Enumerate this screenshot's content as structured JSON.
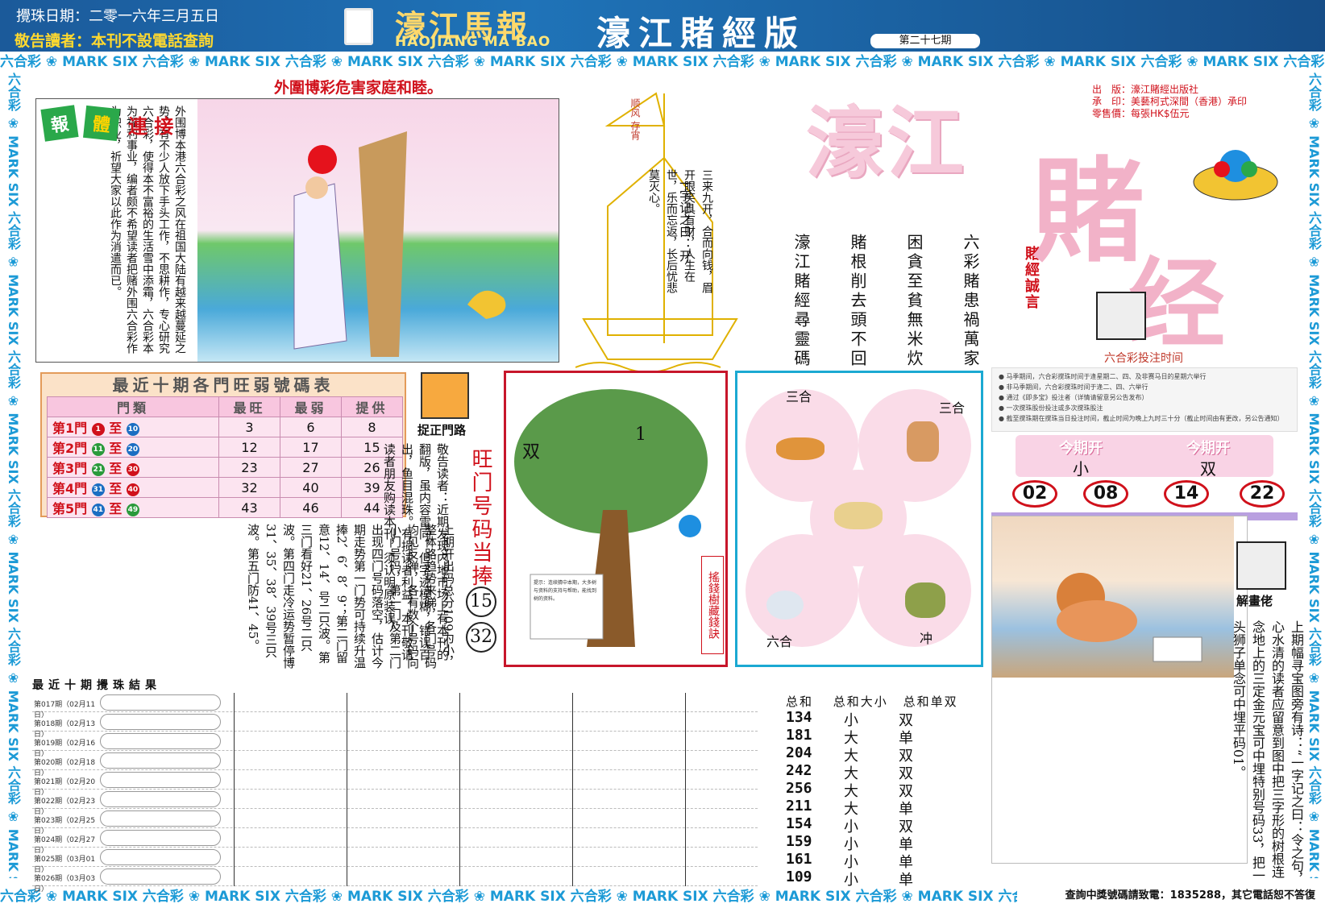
{
  "header": {
    "date": "攪珠日期：二零一六年三月五日",
    "warning": "敬告讀者：本刊不設電話查詢",
    "logo_cn": "濠江馬報",
    "logo_en": "HAOJIANG MA BAO",
    "edition": "濠江賭經版",
    "issue": "第二十七期"
  },
  "strips": {
    "unit": "六合彩 ❀ MARK SIX "
  },
  "slogan": "外圍博彩危害家庭和睦。",
  "story": {
    "badge_left": "報",
    "badge_mid": "體",
    "badge_right": "連 接",
    "text": "外围博本港六合彩之风在祖国大陆有越来越蔓延之势，有不少人放下手头工作，不思耕作，专心研究六合彩，使得本不富裕的生活雪中添霜，六合彩本为福利事业，编者颇不希望读者把赌外围六合彩作为职业，祈望大家以此作为消遣而已。"
  },
  "ship": {
    "flag": "顺风\n存宵",
    "title": "一字记之曰：开",
    "text": "三来九开，合而向钱，眉开眼笑具有财，人生在世，乐而忘返，长后忧悲莫灭心。"
  },
  "proverbs": {
    "label": "賭經誠言",
    "col1": "六彩賭患禍萬家",
    "col2": "困貪至貧無米炊",
    "col3": "賭根削去頭不回",
    "col4": "濠江賭經尋靈碼"
  },
  "bigtitle": {
    "a": "濠江",
    "b": "賭",
    "c": "经"
  },
  "pubinfo": {
    "line1": "出　版：濠江賭經出版社",
    "line2": "承　印：美藝柯式深間（香港）承印",
    "line3": "零售價：每張HK$伍元"
  },
  "bettime": {
    "title": "六合彩投注时间",
    "items": [
      "● 马季期间，六合彩搅珠时间于逢星期二、四、及非赛马日的星期六举行",
      "● 非马季期间，六合彩搅珠时间于逢二、四、六举行",
      "● 通过《即多宝》投注者（详情请留意另公告发布）",
      "● 一次搅珠股份投注或多次搅珠股注",
      "● 截至搅珠期在搅珠当日投注时间，截止时间为晚上九时三十分（截止时间由有更改，另公告通知）"
    ]
  },
  "tonight": {
    "open1": "今期开",
    "value1": "小",
    "open2": "今期开",
    "value2": "双",
    "nums": [
      "02",
      "08",
      "14",
      "22"
    ]
  },
  "hints": {
    "icon_label": "捉正門路",
    "warning_col": "敬告读者：近期发现内地市场上有本刊的翻版，虽内容雷同，但字迹模糊，错误百出，鱼目混珠。有损读者利益，本刊敬请读者朋友购读本刊，须认明原装误。",
    "hot_label": "旺门号码当捧",
    "hot_nums": [
      "15",
      "32"
    ]
  },
  "table": {
    "title": "最近十期各門旺弱號碼表",
    "headers": [
      "門類",
      "最旺",
      "最弱",
      "提供"
    ],
    "rows": [
      {
        "door": "第1門",
        "from": "1",
        "to": "10",
        "from_color": "#d0111b",
        "to_color": "#1b6ec2",
        "max": "3",
        "min": "6",
        "give": "8"
      },
      {
        "door": "第2門",
        "from": "11",
        "to": "20",
        "from_color": "#2a9a3b",
        "to_color": "#1b6ec2",
        "max": "12",
        "min": "17",
        "give": "15"
      },
      {
        "door": "第3門",
        "from": "21",
        "to": "30",
        "from_color": "#2a9a3b",
        "to_color": "#d0111b",
        "max": "23",
        "min": "27",
        "give": "26"
      },
      {
        "door": "第4門",
        "from": "31",
        "to": "40",
        "from_color": "#1b6ec2",
        "to_color": "#d0111b",
        "max": "32",
        "min": "40",
        "give": "39"
      },
      {
        "door": "第5門",
        "from": "41",
        "to": "49",
        "from_color": "#1b6ec2",
        "to_color": "#2a9a3b",
        "max": "43",
        "min": "46",
        "give": "44"
      }
    ],
    "to_word": "至"
  },
  "article": "上期开出码总分109为小，整体路趋势来睇，各门号码均见反弹，各有数个号码向小门号码，第一门及第二门出现四门号码落空，估计今期走势第一门势可持续升温捧2、6、8、9；第二门留意12、14、号二只波。第三门看好21、26号二只波。第四门走冷运势暂停博31、35、38、39号三只波。第五门防41、45。",
  "tree": {
    "label": "搖錢樹藏錢訣",
    "left": "双",
    "right": "1",
    "note": "提示：连续猜中本期，大多树与资料的支持与帮助，能找到树的资料。"
  },
  "zodiac": {
    "tl": "三合",
    "tr": "三合",
    "bl": "六合",
    "br": "冲"
  },
  "cartoon": {
    "label": "解畫佬",
    "text": "上期幅寻宝图旁有诗：“一字记之曰：令之句，心水清的读者应留意到图中把三字形的树根连念地上的三定金元宝可中埋特别号码33，把一头狮子单念可中埋平码01。"
  },
  "results": {
    "title": "最近十期攪珠結果",
    "rows": [
      {
        "label": "第017期（02月11日）"
      },
      {
        "label": "第018期（02月13日）"
      },
      {
        "label": "第019期（02月16日）"
      },
      {
        "label": "第020期（02月18日）"
      },
      {
        "label": "第021期（02月20日）"
      },
      {
        "label": "第022期（02月23日）"
      },
      {
        "label": "第023期（02月25日）"
      },
      {
        "label": "第024期（02月27日）"
      },
      {
        "label": "第025期（03月01日）"
      },
      {
        "label": "第026期（03月03日）"
      }
    ],
    "sum_headers": [
      "总和",
      "总和大小",
      "总和单双"
    ],
    "sums": [
      {
        "total": "134",
        "size": "小",
        "parity": "双"
      },
      {
        "total": "181",
        "size": "大",
        "parity": "单"
      },
      {
        "total": "204",
        "size": "大",
        "parity": "双"
      },
      {
        "total": "242",
        "size": "大",
        "parity": "双"
      },
      {
        "total": "256",
        "size": "大",
        "parity": "双"
      },
      {
        "total": "211",
        "size": "大",
        "parity": "单"
      },
      {
        "total": "154",
        "size": "小",
        "parity": "双"
      },
      {
        "total": "159",
        "size": "小",
        "parity": "单"
      },
      {
        "total": "161",
        "size": "小",
        "parity": "单"
      },
      {
        "total": "109",
        "size": "小",
        "parity": "单"
      }
    ]
  },
  "footer": "查詢中獎號碼請致電：1835288，其它電話恕不答復"
}
